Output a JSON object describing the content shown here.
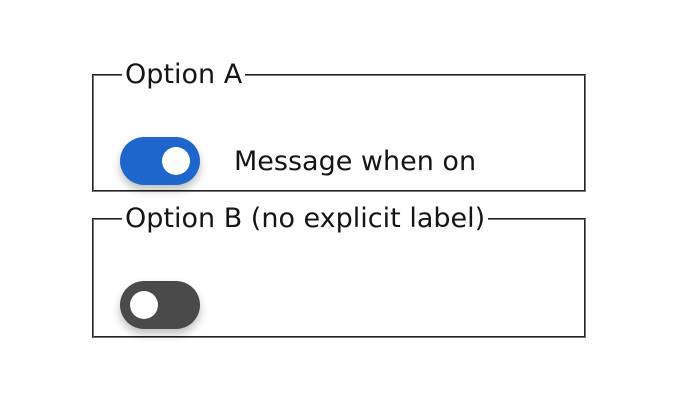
{
  "option_a": {
    "legend": "Option A",
    "switch_state": "on",
    "message": "Message when on",
    "track_color": "#1f66cc"
  },
  "option_b": {
    "legend": "Option B (no explicit label)",
    "switch_state": "off",
    "track_color": "#4a4a4a"
  }
}
